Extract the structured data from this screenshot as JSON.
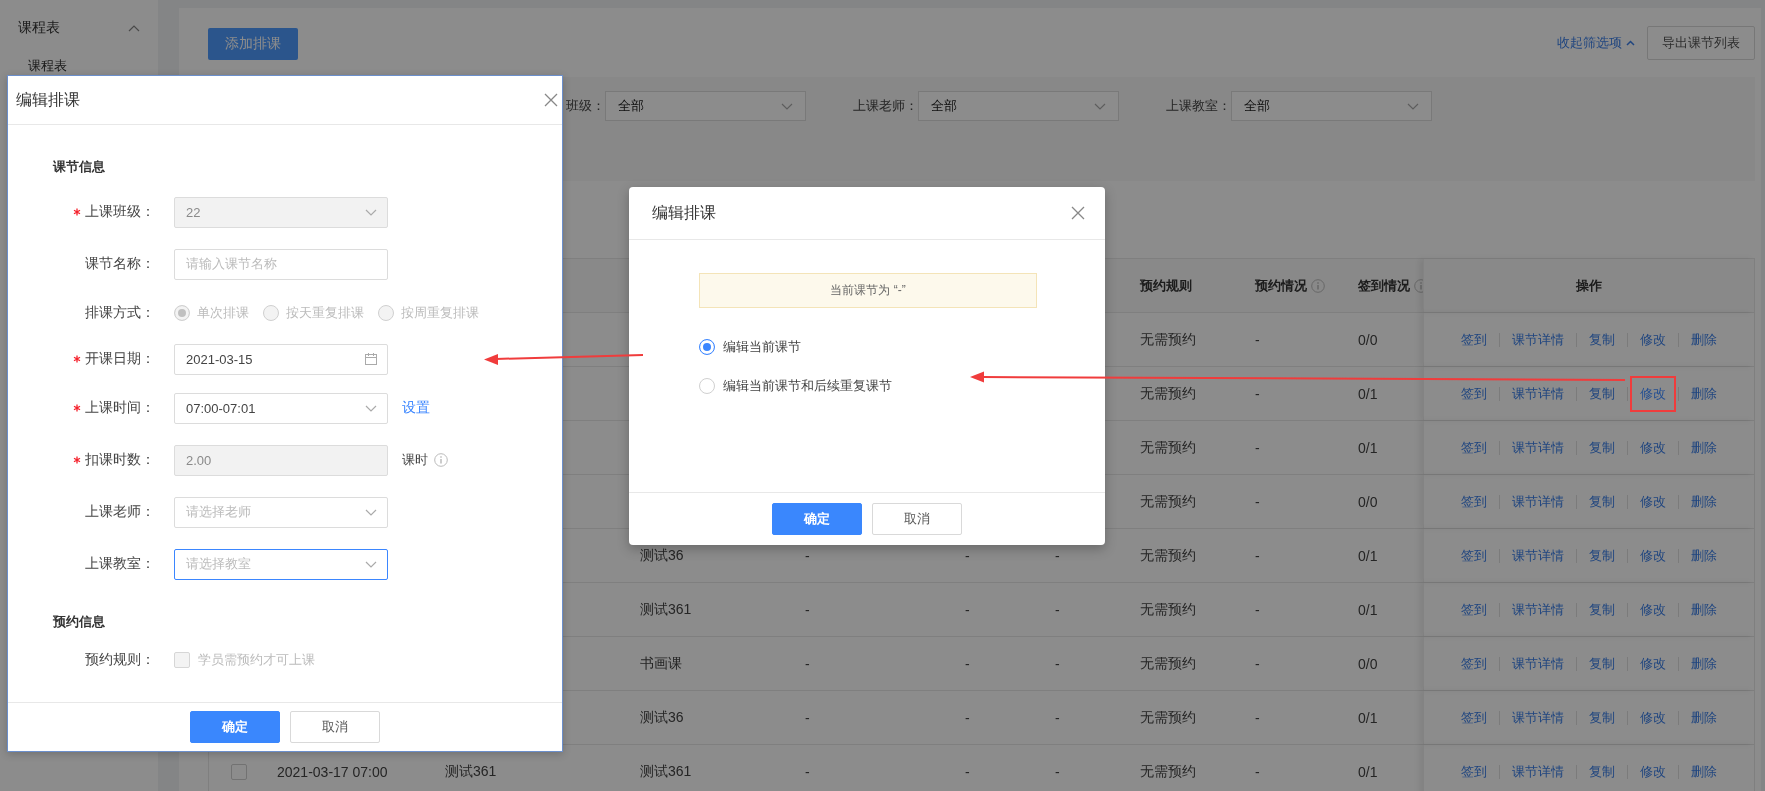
{
  "sidebar": {
    "items": [
      {
        "label": "课程表",
        "expanded": true,
        "children": [
          {
            "label": "课程表"
          }
        ]
      }
    ]
  },
  "toolbar": {
    "add_button": "添加排课",
    "collapse_link": "收起筛选项",
    "export_button": "导出课节列表"
  },
  "filters": [
    {
      "label": "班级：",
      "value": "全部"
    },
    {
      "label": "上课老师：",
      "value": "全部"
    },
    {
      "label": "上课教室：",
      "value": "全部"
    }
  ],
  "table": {
    "header": {
      "column_8": {
        "label": "预约规则"
      },
      "column_9": {
        "label": "预约情况",
        "info": true
      },
      "column_10": {
        "label": "签到情况",
        "info": true
      },
      "column_11": {
        "label": "操作"
      }
    },
    "rows": [
      {
        "cells": {
          "column_8": "无需预约",
          "column_9": "-",
          "column_10": "0/0"
        },
        "actions": [
          {
            "label": "签到",
            "highlighted": false
          },
          {
            "label": "课节详情",
            "highlighted": false
          },
          {
            "label": "复制",
            "highlighted": false
          },
          {
            "label": "修改",
            "highlighted": false
          },
          {
            "label": "删除",
            "highlighted": false
          }
        ]
      },
      {
        "cells": {
          "column_8": "无需预约",
          "column_9": "-",
          "column_10": "0/1"
        },
        "actions": [
          {
            "label": "签到",
            "highlighted": false
          },
          {
            "label": "课节详情",
            "highlighted": false
          },
          {
            "label": "复制",
            "highlighted": false
          },
          {
            "label": "修改",
            "highlighted": true
          },
          {
            "label": "删除",
            "highlighted": false
          }
        ]
      },
      {
        "cells": {
          "column_8": "无需预约",
          "column_9": "-",
          "column_10": "0/1"
        },
        "actions": [
          {
            "label": "签到",
            "highlighted": false
          },
          {
            "label": "课节详情",
            "highlighted": false
          },
          {
            "label": "复制",
            "highlighted": false
          },
          {
            "label": "修改",
            "highlighted": false
          },
          {
            "label": "删除",
            "highlighted": false
          }
        ]
      },
      {
        "cells": {
          "column_8": "无需预约",
          "column_9": "-",
          "column_10": "0/0"
        },
        "actions": [
          {
            "label": "签到",
            "highlighted": false
          },
          {
            "label": "课节详情",
            "highlighted": false
          },
          {
            "label": "复制",
            "highlighted": false
          },
          {
            "label": "修改",
            "highlighted": false
          },
          {
            "label": "删除",
            "highlighted": false
          }
        ]
      },
      {
        "cells": {
          "column_4": "测试36",
          "column_5": "-",
          "column_6": "-",
          "column_7": "-",
          "column_8": "无需预约",
          "column_9": "-",
          "column_10": "0/1"
        },
        "actions": [
          {
            "label": "签到",
            "highlighted": false
          },
          {
            "label": "课节详情",
            "highlighted": false
          },
          {
            "label": "复制",
            "highlighted": false
          },
          {
            "label": "修改",
            "highlighted": false
          },
          {
            "label": "删除",
            "highlighted": false
          }
        ]
      },
      {
        "cells": {
          "column_4": "测试361",
          "column_5": "-",
          "column_6": "-",
          "column_7": "-",
          "column_8": "无需预约",
          "column_9": "-",
          "column_10": "0/1"
        },
        "actions": [
          {
            "label": "签到",
            "highlighted": false
          },
          {
            "label": "课节详情",
            "highlighted": false
          },
          {
            "label": "复制",
            "highlighted": false
          },
          {
            "label": "修改",
            "highlighted": false
          },
          {
            "label": "删除",
            "highlighted": false
          }
        ]
      },
      {
        "cells": {
          "column_4": "书画课",
          "column_5": "-",
          "column_6": "-",
          "column_7": "-",
          "column_8": "无需预约",
          "column_9": "-",
          "column_10": "0/0"
        },
        "actions": [
          {
            "label": "签到",
            "highlighted": false
          },
          {
            "label": "课节详情",
            "highlighted": false
          },
          {
            "label": "复制",
            "highlighted": false
          },
          {
            "label": "修改",
            "highlighted": false
          },
          {
            "label": "删除",
            "highlighted": false
          }
        ]
      },
      {
        "cells": {
          "column_4": "测试36",
          "column_5": "-",
          "column_6": "-",
          "column_7": "-",
          "column_8": "无需预约",
          "column_9": "-",
          "column_10": "0/1"
        },
        "actions": [
          {
            "label": "签到",
            "highlighted": false
          },
          {
            "label": "课节详情",
            "highlighted": false
          },
          {
            "label": "复制",
            "highlighted": false
          },
          {
            "label": "修改",
            "highlighted": false
          },
          {
            "label": "删除",
            "highlighted": false
          }
        ]
      },
      {
        "checked": false,
        "cells": {
          "column_2": "2021-03-17 07:00",
          "column_3": "测试361",
          "column_4": "测试361",
          "column_5": "-",
          "column_6": "-",
          "column_7": "-",
          "column_8": "无需预约",
          "column_9": "-",
          "column_10": "0/1"
        },
        "actions": [
          {
            "label": "签到",
            "highlighted": false
          },
          {
            "label": "课节详情",
            "highlighted": false
          },
          {
            "label": "复制",
            "highlighted": false
          },
          {
            "label": "修改",
            "highlighted": false
          },
          {
            "label": "删除",
            "highlighted": false
          }
        ]
      }
    ]
  },
  "edit_dialog": {
    "title": "编辑排课",
    "sections": [
      {
        "title": "课节信息",
        "fields": [
          {
            "kind": "select",
            "label": "上课班级：",
            "required": true,
            "disabled": true,
            "value": "22"
          },
          {
            "kind": "input",
            "label": "课节名称：",
            "disabled": false,
            "placeholder": "请输入课节名称"
          },
          {
            "kind": "radio",
            "label": "排课方式：",
            "disabled": true,
            "options": [
              {
                "label": "单次排课",
                "selected": true
              },
              {
                "label": "按天重复排课",
                "selected": false
              },
              {
                "label": "按周重复排课",
                "selected": false
              }
            ]
          },
          {
            "kind": "date",
            "label": "开课日期：",
            "required": true,
            "disabled": false,
            "value": "2021-03-15"
          },
          {
            "kind": "select",
            "label": "上课时间：",
            "required": true,
            "disabled": false,
            "value": "07:00-07:01",
            "link": "设置"
          },
          {
            "kind": "input",
            "label": "扣课时数：",
            "required": true,
            "disabled": true,
            "value": "2.00",
            "suffix": "课时",
            "info": true
          },
          {
            "kind": "select",
            "label": "上课老师：",
            "disabled": false,
            "placeholder": "请选择老师"
          },
          {
            "kind": "select",
            "label": "上课教室：",
            "disabled": false,
            "focused": true,
            "placeholder": "请选择教室"
          }
        ]
      },
      {
        "title": "预约信息",
        "fields": [
          {
            "kind": "checkbox",
            "label": "预约规则：",
            "disabled": true,
            "checked": false,
            "text": "学员需预约才可上课"
          }
        ]
      }
    ],
    "buttons": [
      {
        "label": "确定",
        "kind": "primary"
      },
      {
        "label": "取消",
        "kind": "default"
      }
    ]
  },
  "confirm_dialog": {
    "title": "编辑排课",
    "notice": "当前课节为 “-”",
    "options": [
      {
        "label": "编辑当前课节",
        "selected": true
      },
      {
        "label": "编辑当前课节和后续重复课节",
        "selected": false
      }
    ],
    "buttons": [
      {
        "label": "确定",
        "kind": "primary"
      },
      {
        "label": "取消",
        "kind": "default"
      }
    ]
  }
}
